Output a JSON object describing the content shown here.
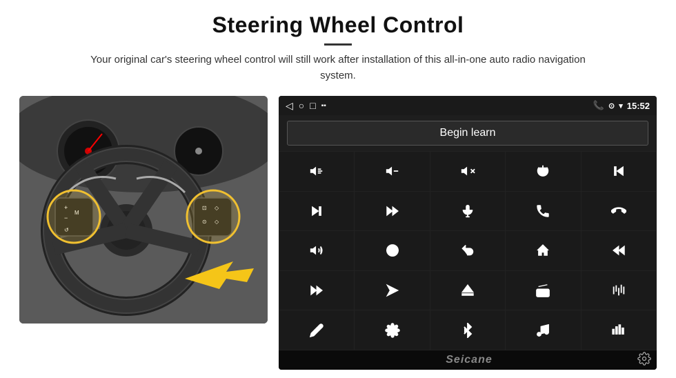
{
  "header": {
    "title": "Steering Wheel Control",
    "subtitle": "Your original car's steering wheel control will still work after installation of this all-in-one auto radio navigation system."
  },
  "screen": {
    "status_bar": {
      "back_icon": "◁",
      "home_icon": "○",
      "square_icon": "□",
      "sd_icon": "▪▪",
      "phone_icon": "📞",
      "location_icon": "⊙",
      "wifi_icon": "▾",
      "time": "15:52"
    },
    "begin_learn_label": "Begin learn",
    "seicane_logo": "Seicane"
  },
  "controls": [
    {
      "icon": "vol+",
      "unicode": "🔊+"
    },
    {
      "icon": "vol-",
      "unicode": "🔉−"
    },
    {
      "icon": "mute",
      "unicode": "🔇"
    },
    {
      "icon": "power",
      "unicode": "⏻"
    },
    {
      "icon": "prev-track",
      "unicode": "⏮"
    },
    {
      "icon": "next",
      "unicode": "⏭"
    },
    {
      "icon": "fast-fwd",
      "unicode": "⏩"
    },
    {
      "icon": "mic",
      "unicode": "🎤"
    },
    {
      "icon": "phone",
      "unicode": "📞"
    },
    {
      "icon": "hang-up",
      "unicode": "📵"
    },
    {
      "icon": "horn",
      "unicode": "📢"
    },
    {
      "icon": "360",
      "unicode": "⟳"
    },
    {
      "icon": "back",
      "unicode": "↩"
    },
    {
      "icon": "home",
      "unicode": "⌂"
    },
    {
      "icon": "skip-back",
      "unicode": "⏮"
    },
    {
      "icon": "fast-fwd2",
      "unicode": "⏭"
    },
    {
      "icon": "nav",
      "unicode": "▶"
    },
    {
      "icon": "eject",
      "unicode": "⏏"
    },
    {
      "icon": "radio",
      "unicode": "📻"
    },
    {
      "icon": "eq",
      "unicode": "🎛"
    },
    {
      "icon": "pen",
      "unicode": "✏"
    },
    {
      "icon": "settings2",
      "unicode": "⚙"
    },
    {
      "icon": "bt",
      "unicode": "⚡"
    },
    {
      "icon": "music",
      "unicode": "♪"
    },
    {
      "icon": "bars",
      "unicode": "⋮"
    }
  ]
}
